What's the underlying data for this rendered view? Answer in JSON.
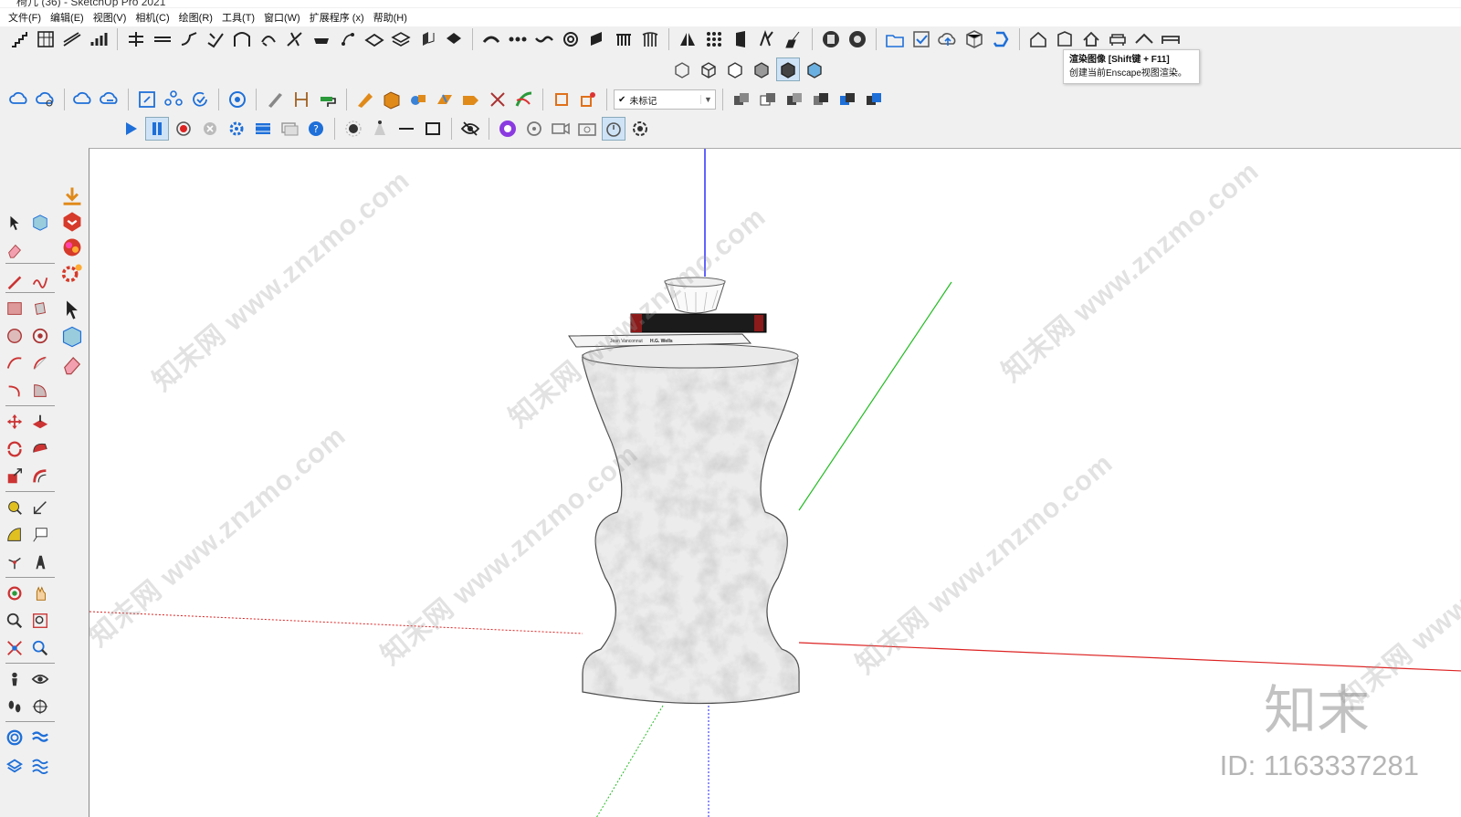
{
  "window": {
    "title": "椅几 (36) - SketchUp Pro 2021"
  },
  "menu": [
    "文件(F)",
    "编辑(E)",
    "视图(V)",
    "相机(C)",
    "绘图(R)",
    "工具(T)",
    "窗口(W)",
    "扩展程序 (x)",
    "帮助(H)"
  ],
  "tooltip": {
    "title": "渲染图像 [Shift键 + F11]",
    "description": "创建当前Enscape视图渲染。"
  },
  "tag_dropdown": {
    "value": "未标记",
    "checked_mark": "✔"
  },
  "scene": {
    "book_top_title": "",
    "book_bottom_author": "Jean Vanconnut",
    "book_bottom_title": "H.G. Wells"
  },
  "watermark": {
    "text": "知末网 www.znzmo.com",
    "brand": "知末",
    "id_label": "ID: 1163337281"
  },
  "colors": {
    "axis_blue": "#2020ff",
    "axis_green": "#22bb22",
    "axis_red": "#dd2222",
    "accent_blue": "#1e6fd8"
  }
}
